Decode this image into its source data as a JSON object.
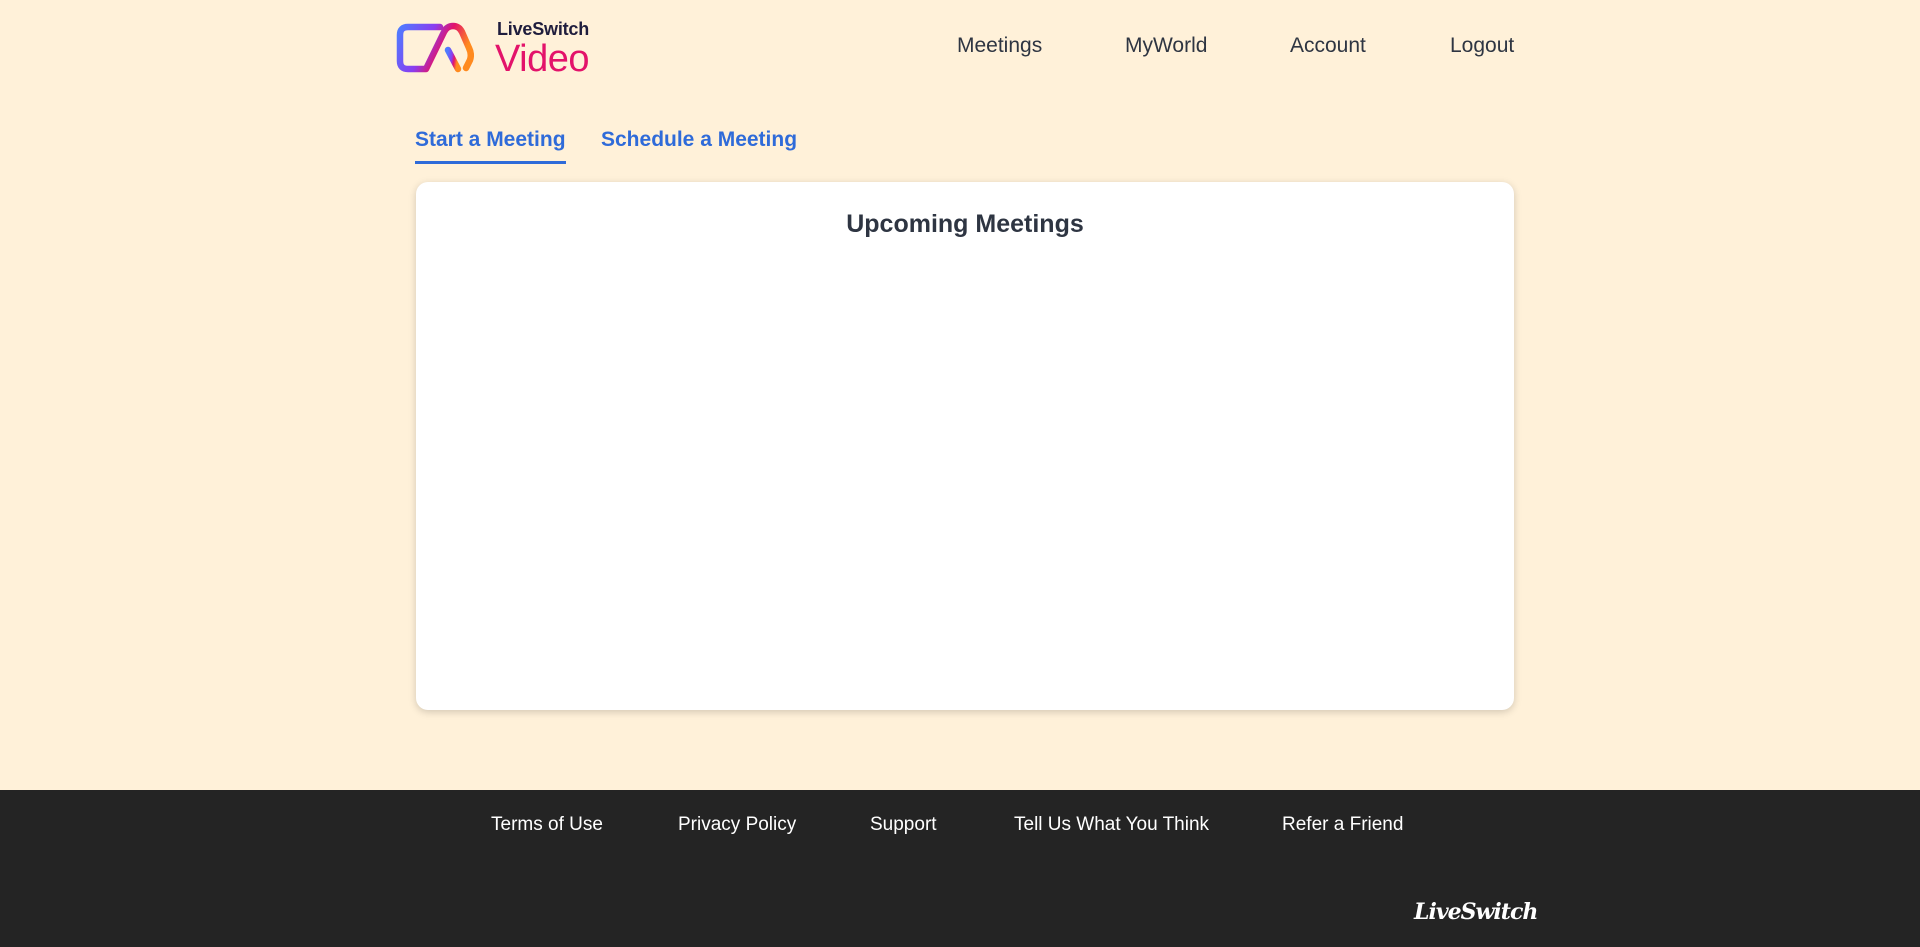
{
  "header": {
    "logo": {
      "brand": "LiveSwitch",
      "product": "Video",
      "colors": {
        "gradient_start": "#5b6cff",
        "gradient_mid": "#e3136a",
        "gradient_end": "#ff8a1f",
        "brand_text": "#1f1d3d",
        "product_text": "#e3136a"
      }
    },
    "nav": [
      {
        "label": "Meetings"
      },
      {
        "label": "MyWorld"
      },
      {
        "label": "Account"
      },
      {
        "label": "Logout"
      }
    ]
  },
  "tabs": [
    {
      "label": "Start a Meeting",
      "active": true
    },
    {
      "label": "Schedule a Meeting",
      "active": false
    }
  ],
  "card": {
    "title": "Upcoming Meetings"
  },
  "footer": {
    "links": [
      {
        "label": "Terms of Use"
      },
      {
        "label": "Privacy Policy"
      },
      {
        "label": "Support"
      },
      {
        "label": "Tell Us What You Think"
      },
      {
        "label": "Refer a Friend"
      }
    ],
    "logo_text": "LiveSwitch"
  },
  "colors": {
    "page_background": "#fff1d9",
    "accent": "#2f6bd9",
    "text": "#2e3542",
    "footer_background": "#242424"
  }
}
